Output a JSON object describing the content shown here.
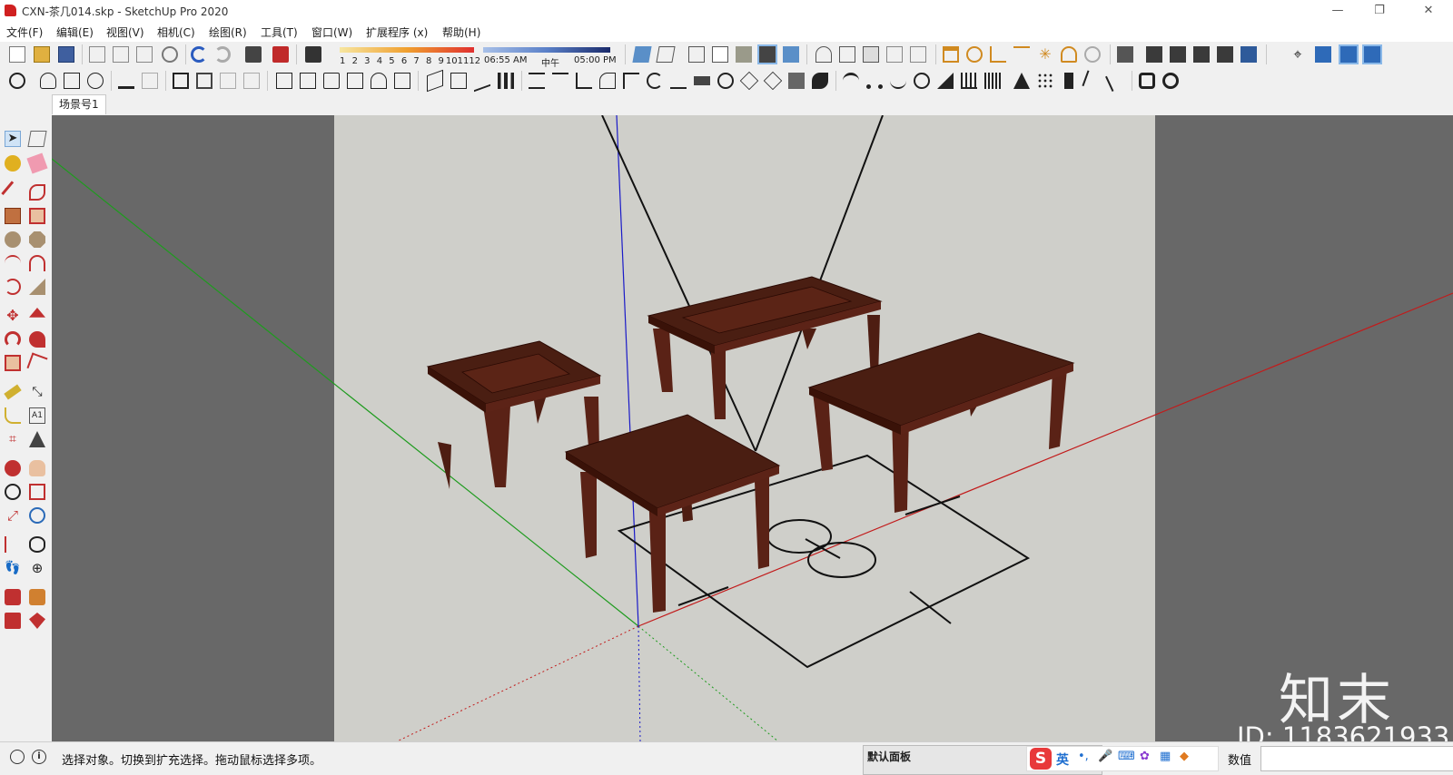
{
  "window": {
    "title": "CXN-茶几014.skp - SketchUp Pro 2020",
    "controls": [
      "—",
      "❐",
      "✕"
    ]
  },
  "menu": {
    "items": [
      "文件(F)",
      "编辑(E)",
      "视图(V)",
      "相机(C)",
      "绘图(R)",
      "工具(T)",
      "窗口(W)",
      "扩展程序 (x)",
      "帮助(H)"
    ]
  },
  "shadow_toolbar": {
    "months": [
      "1",
      "2",
      "3",
      "4",
      "5",
      "6",
      "7",
      "8",
      "9",
      "10",
      "11",
      "12"
    ],
    "time_start": "06:55 AM",
    "time_mid": "中午",
    "time_end": "05:00 PM"
  },
  "scene_tabs": {
    "active": "场景号1"
  },
  "status": {
    "hint": "选择对象。切换到扩充选择。拖动鼠标选择多项。",
    "vcb_label": "数值",
    "vcb_value": "",
    "tray_title": "默认面板",
    "ime_logo": "S",
    "ime_lang": "英"
  },
  "watermark": {
    "logo": "知末",
    "id": "ID: 1183621933"
  },
  "colors": {
    "viewport_bg": "#686868",
    "model_bg": "#cfcfca",
    "table_top": "#4a1e12",
    "table_leg": "#5a2216",
    "axis_red": "#c21b1b",
    "axis_green": "#1e9b1e",
    "axis_blue": "#1a1ac8"
  }
}
